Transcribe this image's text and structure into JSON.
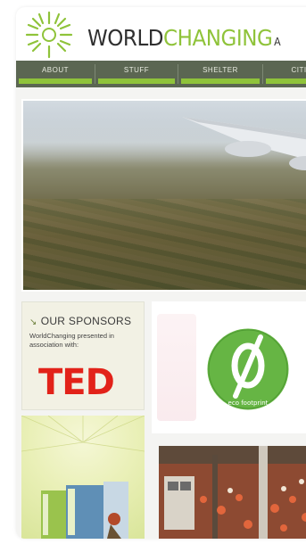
{
  "site": {
    "logo_parts": [
      "WORLD",
      "CHANGING",
      "A"
    ],
    "colors": {
      "accent": "#8fc33a",
      "nav_bg": "#5b6652",
      "ted_red": "#e22219"
    }
  },
  "nav": {
    "items": [
      {
        "label": "ABOUT"
      },
      {
        "label": "STUFF"
      },
      {
        "label": "SHELTER"
      },
      {
        "label": "CITI"
      }
    ]
  },
  "hero": {
    "icon": "airplane-wing-aerial-photo"
  },
  "sponsors": {
    "title": "OUR SPONSORS",
    "text": "WorldChanging presented in association with:",
    "ted_logo": "TED"
  },
  "ecological_footprint": {
    "badge_text": "eco footprint"
  }
}
